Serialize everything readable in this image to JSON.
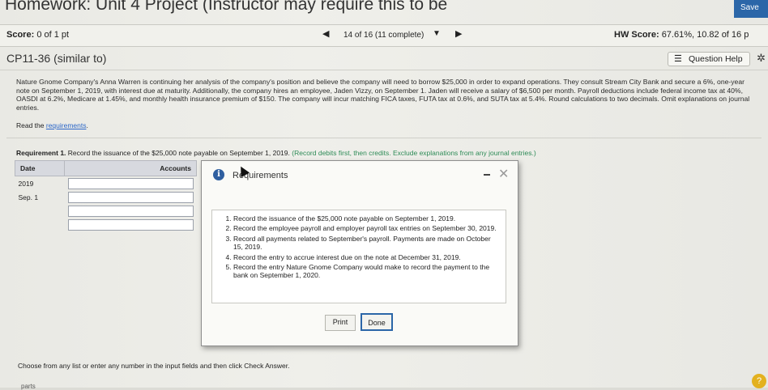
{
  "header": {
    "title": "Homework: Unit 4 Project (Instructor may require this to be",
    "save_label": "Save"
  },
  "scorebar": {
    "score_label": "Score:",
    "score_value": "0 of 1 pt",
    "nav_text": "14 of 16 (11 complete)",
    "hw_score_label": "HW Score:",
    "hw_score_value": "67.61%, 10.82 of 16 p"
  },
  "question": {
    "id": "CP11-36 (similar to)",
    "help_label": "Question Help"
  },
  "problem_text": "Nature Gnome Company's Anna Warren is continuing her analysis of the company's position and believe the company will need to borrow $25,000 in order to expand operations. They consult Stream City Bank and secure a 6%, one-year note on September 1, 2019, with interest due at maturity. Additionally, the company hires an employee, Jaden Vizzy, on September 1. Jaden will receive a salary of $6,500 per month. Payroll deductions include federal income tax at 40%, OASDI at 6.2%, Medicare at 1.45%, and monthly health insurance premium of $150. The company will incur matching FICA taxes, FUTA tax at 0.6%, and SUTA tax at 5.4%. Round calculations to two decimals. Omit explanations on journal entries.",
  "read_requirements": {
    "prefix": "Read the",
    "link": "requirements",
    "suffix": "."
  },
  "requirement1": {
    "label": "Requirement 1.",
    "text": "Record the issuance of the $25,000 note payable on September 1, 2019.",
    "hint": "(Record debits first, then credits. Exclude explanations from any journal entries.)"
  },
  "journal": {
    "col_date": "Date",
    "col_accounts": "Accounts",
    "year": "2019",
    "date": "Sep. 1"
  },
  "modal": {
    "title": "Requirements",
    "items": [
      "Record the issuance of the $25,000 note payable on September 1, 2019.",
      "Record the employee payroll and employer payroll tax entries on September 30, 2019.",
      "Record all payments related to September's payroll. Payments are made on October 15, 2019.",
      "Record the entry to accrue interest due on the note at December 31, 2019.",
      "Record the entry Nature Gnome Company would make to record the payment to the bank on September 1, 2020."
    ],
    "print_label": "Print",
    "done_label": "Done"
  },
  "instructions": "Choose from any list or enter any number in the input fields and then click Check Answer.",
  "footer": {
    "parts": "parts"
  },
  "colors": {
    "accent": "#2b66a8",
    "link": "#2b66c8",
    "hint_green": "#2e8b57"
  }
}
